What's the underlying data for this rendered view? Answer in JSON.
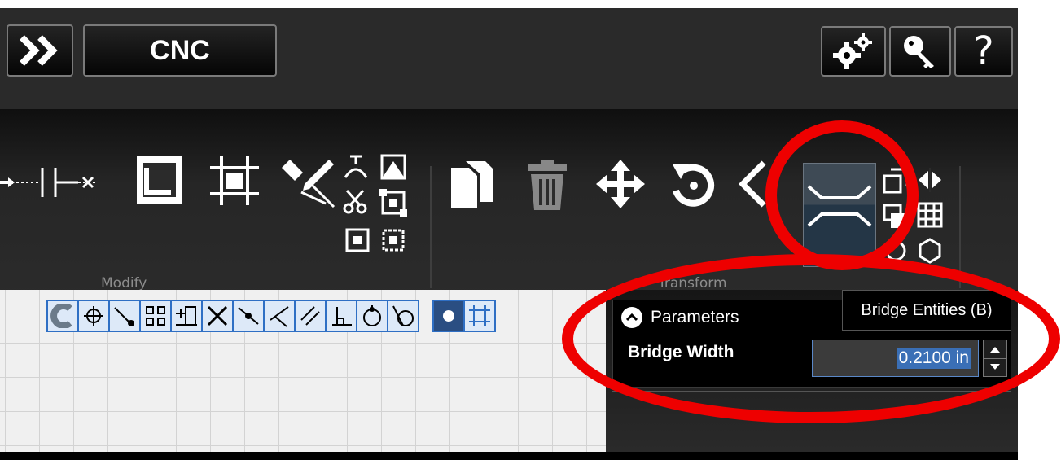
{
  "header": {
    "expand_icon": "double-chevron-right-icon",
    "workspace_label": "CNC",
    "settings_icon": "gears-icon",
    "license_icon": "key-icon",
    "help_label": "?"
  },
  "ribbon": {
    "groups": [
      {
        "label": "Modify"
      },
      {
        "label": "Transform"
      }
    ],
    "modify_tools": [
      "extend-icon",
      "trim-icon",
      "fillet-icon",
      "corner-icon",
      "edit-icon",
      "break-icon",
      "scissors-icon",
      "explode-icon",
      "join-icon",
      "node-icon"
    ],
    "transform_tools": [
      "copy-icon",
      "delete-icon",
      "move-icon",
      "rotate-icon",
      "mirror-icon",
      "bridge-icon",
      "offset-icon",
      "array-icon",
      "scale-icon",
      "grid-icon",
      "polygon-icon"
    ]
  },
  "snap_tools": [
    "magnet-icon",
    "center-icon",
    "endpoint-icon",
    "grid-snap-icon",
    "dimension-icon",
    "intersection-icon",
    "midpoint-icon",
    "angle-icon",
    "parallel-icon",
    "perpendicular-icon",
    "quadrant-icon",
    "tangent-icon"
  ],
  "parameters": {
    "title": "Parameters",
    "field_label": "Bridge Width",
    "field_value": "0.2100 in"
  },
  "tooltip": {
    "text": "Bridge Entities (B)"
  },
  "colors": {
    "annotation": "#ee0000",
    "selection": "#3a6fb6",
    "snap_border": "#2f6fc4"
  }
}
